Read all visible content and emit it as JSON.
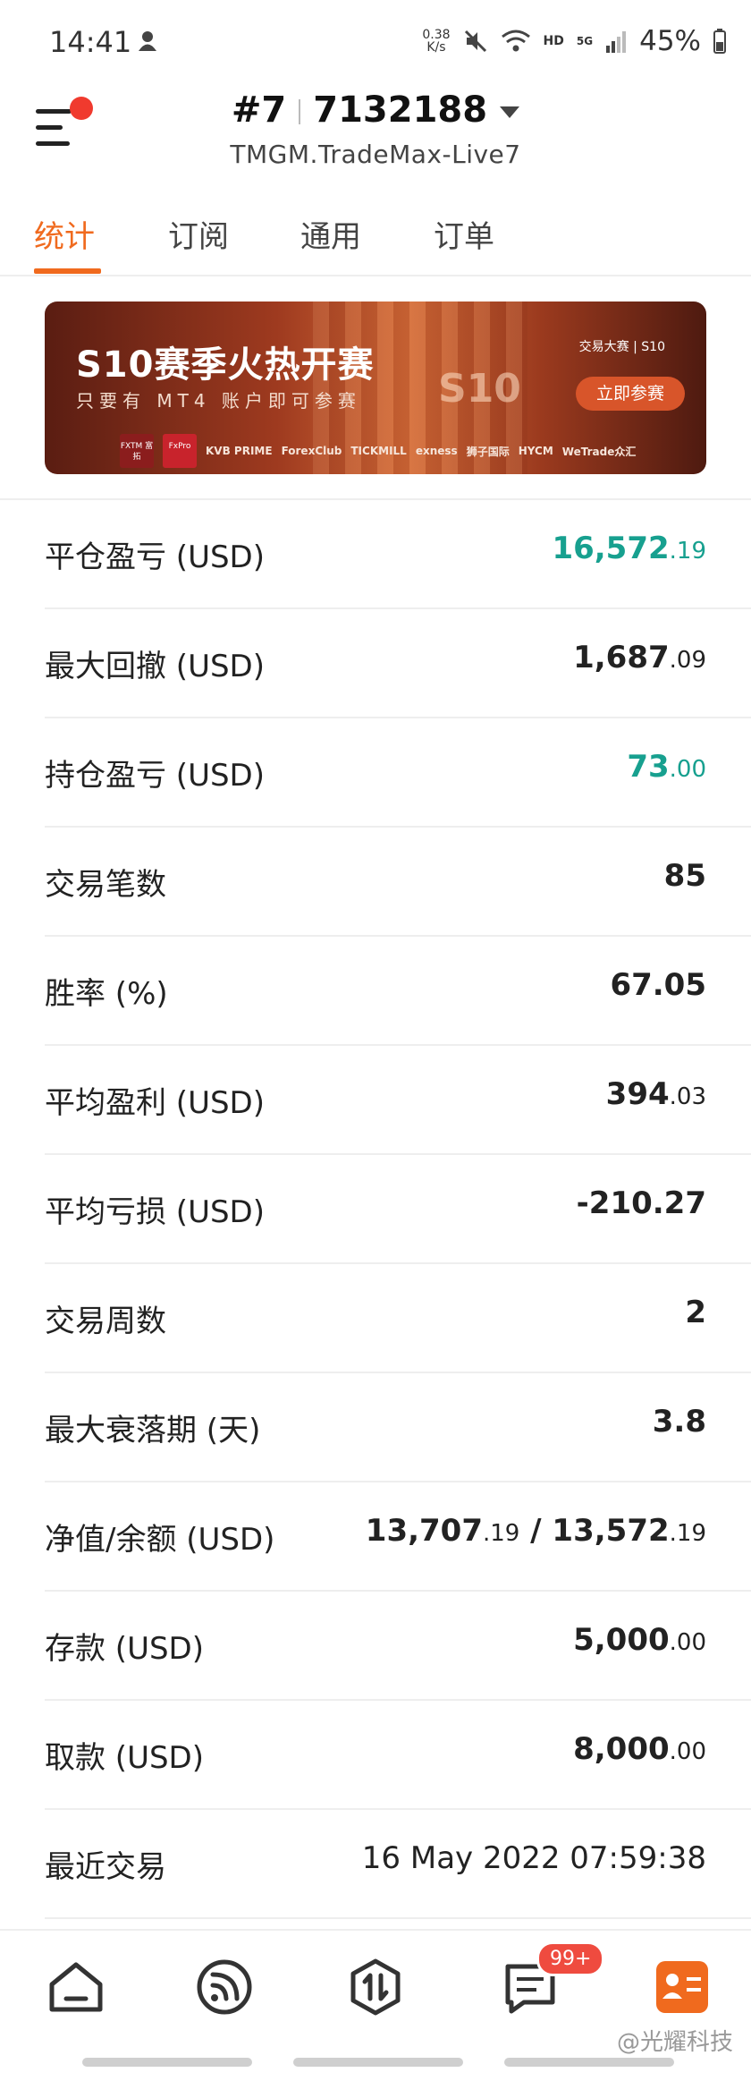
{
  "status_bar": {
    "time": "14:41",
    "net_speed_value": "0.38",
    "net_speed_unit": "K/s",
    "network": "HD",
    "signal": "5G",
    "battery": "45%"
  },
  "header": {
    "account_prefix": "#7",
    "account_number": "7132188",
    "server": "TMGM.TradeMax-Live7"
  },
  "tabs": [
    {
      "label": "统计",
      "active": true
    },
    {
      "label": "订阅",
      "active": false
    },
    {
      "label": "通用",
      "active": false
    },
    {
      "label": "订单",
      "active": false
    }
  ],
  "banner": {
    "title": "S10赛季火热开赛",
    "subtitle": "只要有 MT4 账户即可参赛",
    "center_mark": "S10",
    "brand": "交易大赛 | S10",
    "cta": "立即参赛",
    "partners": [
      "FXTM 富拓",
      "FxPro",
      "KVB PRIME",
      "ForexClub",
      "TICKMILL",
      "exness",
      "狮子国际",
      "HYCM",
      "WeTrade众汇"
    ]
  },
  "stats": [
    {
      "label": "平仓盈亏 (USD)",
      "int": "16,572",
      "dec": ".19",
      "positive": true
    },
    {
      "label": "最大回撤 (USD)",
      "int": "1,687",
      "dec": ".09",
      "positive": false
    },
    {
      "label": "持仓盈亏 (USD)",
      "int": "73",
      "dec": ".00",
      "positive": true
    },
    {
      "label": "交易笔数",
      "int": "85",
      "dec": "",
      "positive": false
    },
    {
      "label": "胜率 (%)",
      "int": "67.05",
      "dec": "",
      "positive": false
    },
    {
      "label": "平均盈利 (USD)",
      "int": "394",
      "dec": ".03",
      "positive": false
    },
    {
      "label": "平均亏损 (USD)",
      "int": "-210.27",
      "dec": "",
      "positive": false
    },
    {
      "label": "交易周数",
      "int": "2",
      "dec": "",
      "positive": false
    },
    {
      "label": "最大衰落期 (天)",
      "int": "3.8",
      "dec": "",
      "positive": false
    },
    {
      "label": "净值/余额 (USD)",
      "int": "13,707",
      "dec": ".19",
      "int2": " / 13,572",
      "dec2": ".19",
      "positive": false
    },
    {
      "label": "存款 (USD)",
      "int": "5,000",
      "dec": ".00",
      "positive": false
    },
    {
      "label": "取款 (USD)",
      "int": "8,000",
      "dec": ".00",
      "positive": false
    },
    {
      "label": "最近交易",
      "int": "16 May 2022 07:59:38",
      "dec": "",
      "positive": false
    }
  ],
  "bottom_nav": {
    "items": [
      "home-icon",
      "feed-icon",
      "trade-icon",
      "messages-icon",
      "account-icon"
    ],
    "badge": "99+",
    "active_color": "#f06a1e"
  },
  "watermark": "@光耀科技",
  "colors": {
    "accent": "#f06a1e",
    "positive": "#17a08f",
    "badge": "#ef4b3f"
  }
}
